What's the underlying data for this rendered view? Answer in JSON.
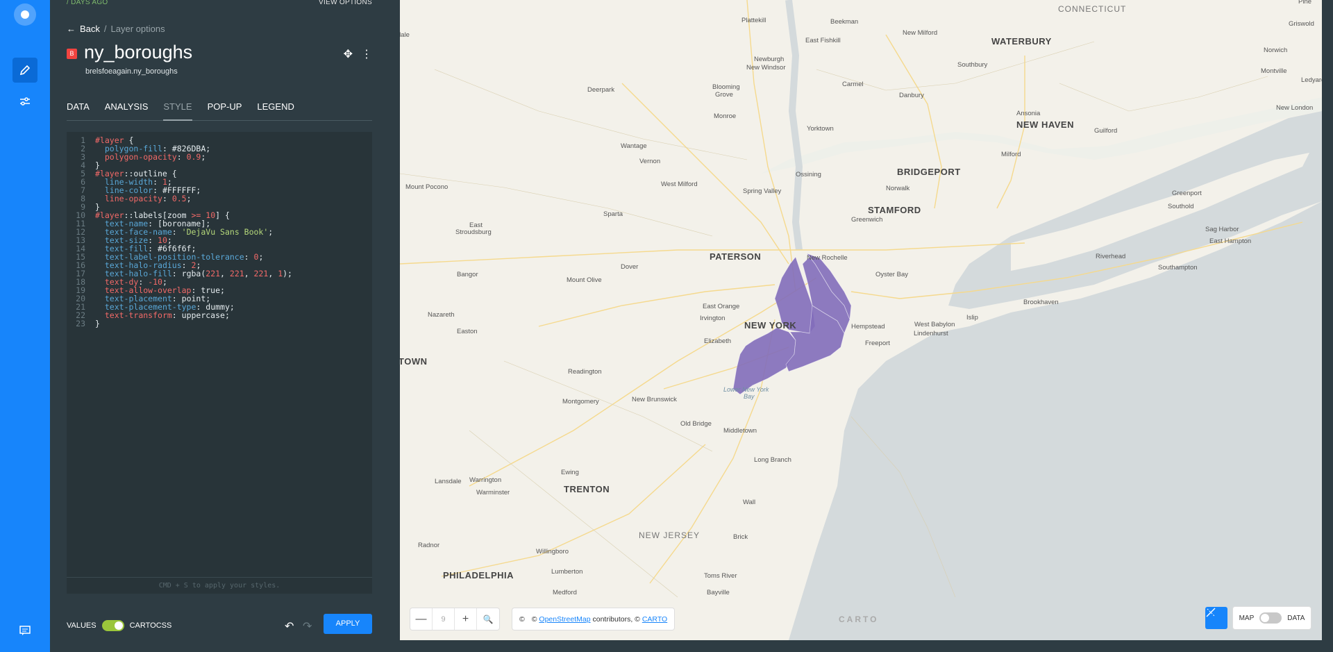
{
  "nav": {
    "icons": [
      "logo-icon",
      "pencil-icon",
      "sliders-icon",
      "chat-icon"
    ]
  },
  "panel": {
    "days_ago": "/ DAYS AGO",
    "view_options": "VIEW OPTIONS",
    "back": "Back",
    "crumb_sep": "/",
    "crumb_current": "Layer options",
    "badge": "B",
    "layer_name": "ny_boroughs",
    "dataset": "brelsfoeagain.ny_boroughs",
    "tabs": [
      "DATA",
      "ANALYSIS",
      "STYLE",
      "POP-UP",
      "LEGEND"
    ],
    "active_tab": "STYLE",
    "code_lines": [
      "#layer {",
      "  polygon-fill: #826DBA;",
      "  polygon-opacity: 0.9;",
      "}",
      "#layer::outline {",
      "  line-width: 1;",
      "  line-color: #FFFFFF;",
      "  line-opacity: 0.5;",
      "}",
      "#layer::labels[zoom >= 10] {",
      "  text-name: [boroname];",
      "  text-face-name: 'DejaVu Sans Book';",
      "  text-size: 10;",
      "  text-fill: #6f6f6f;",
      "  text-label-position-tolerance: 0;",
      "  text-halo-radius: 2;",
      "  text-halo-fill: rgba(221, 221, 221, 1);",
      "  text-dy: -10;",
      "  text-allow-overlap: true;",
      "  text-placement: point;",
      "  text-placement-type: dummy;",
      "  text-transform: uppercase;",
      "}"
    ],
    "editor_hint": "CMD + S to apply your styles.",
    "values_label": "VALUES",
    "cartocss_label": "CARTOCSS",
    "apply": "APPLY"
  },
  "map": {
    "zoom_level": "9",
    "zoom_out": "—",
    "zoom_in": "+",
    "attribution_prefix": "©",
    "attribution_c": "©",
    "osm": "OpenStreetMap",
    "attribution_mid": "contributors, ©",
    "carto": "CARTO",
    "carto_logo": "CARTO",
    "map_label": "MAP",
    "data_label": "DATA",
    "fill_color": "#826DBA",
    "labels": {
      "connecticut": "CONNECTICUT",
      "new_haven": "NEW HAVEN",
      "bridgeport": "BRIDGEPORT",
      "stamford": "STAMFORD",
      "paterson": "PATERSON",
      "new_york": "NEW YORK",
      "trenton": "TRENTON",
      "new_jersey": "NEW JERSEY",
      "philadelphia": "PHILADELPHIA",
      "waterbury": "WATERBURY",
      "plattekill": "Plattekill",
      "beekman": "Beekman",
      "pine": "Pine",
      "newburgh": "Newburgh",
      "new_windsor": "New Windsor",
      "east_fishkill": "East Fishkill",
      "new_milford": "New Milford",
      "southbury": "Southbury",
      "griswold": "Griswold",
      "norwich": "Norwich",
      "montville": "Montville",
      "ledyard": "Ledyard",
      "new_london": "New London",
      "deerpark": "Deerpark",
      "blooming_grove": "Blooming",
      "blooming_grove2": "Grove",
      "monroe": "Monroe",
      "carmel": "Carmel",
      "danbury": "Danbury",
      "ansonia": "Ansonia",
      "guilford": "Guilford",
      "milford": "Milford",
      "yorktown": "Yorktown",
      "wantage": "Wantage",
      "vernon": "Vernon",
      "ossining": "Ossining",
      "west_milford": "West Milford",
      "norwalk": "Norwalk",
      "mount_pocono": "Mount Pocono",
      "spring_valley": "Spring Valley",
      "greenport": "Greenport",
      "southold": "Southold",
      "sparta": "Sparta",
      "greenwich": "Greenwich",
      "east_stroudsburg": "East",
      "east_stroudsburg2": "Stroudsburg",
      "sag_harbor": "Sag Harbor",
      "east_hampton": "East Hampton",
      "riverhead": "Riverhead",
      "new_rochelle": "New Rochelle",
      "southampton": "Southampton",
      "bangor": "Bangor",
      "dover": "Dover",
      "oyster_bay": "Oyster Bay",
      "mount_olive": "Mount Olive",
      "brookhaven": "Brookhaven",
      "east_orange": "East Orange",
      "nazareth": "Nazareth",
      "irvington": "Irvington",
      "hempstead": "Hempstead",
      "west_babylon": "West Babylon",
      "islip": "Islip",
      "lindenhurst": "Lindenhurst",
      "easton": "Easton",
      "elizabeth": "Elizabeth",
      "freeport": "Freeport",
      "town": "TOWN",
      "readington": "Readington",
      "lower_ny_bay": "Lower New York",
      "lower_ny_bay2": "Bay",
      "montgomery": "Montgomery",
      "new_brunswick": "New Brunswick",
      "old_bridge": "Old Bridge",
      "middletown": "Middletown",
      "long_branch": "Long Branch",
      "ewing": "Ewing",
      "lansdale": "Lansdale",
      "warrington": "Warrington",
      "warminster": "Warminster",
      "wall": "Wall",
      "radnor": "Radnor",
      "brick": "Brick",
      "willingboro": "Willingboro",
      "lumberton": "Lumberton",
      "toms_river": "Toms River",
      "medford": "Medford",
      "bayville": "Bayville",
      "dale": "dale"
    }
  }
}
